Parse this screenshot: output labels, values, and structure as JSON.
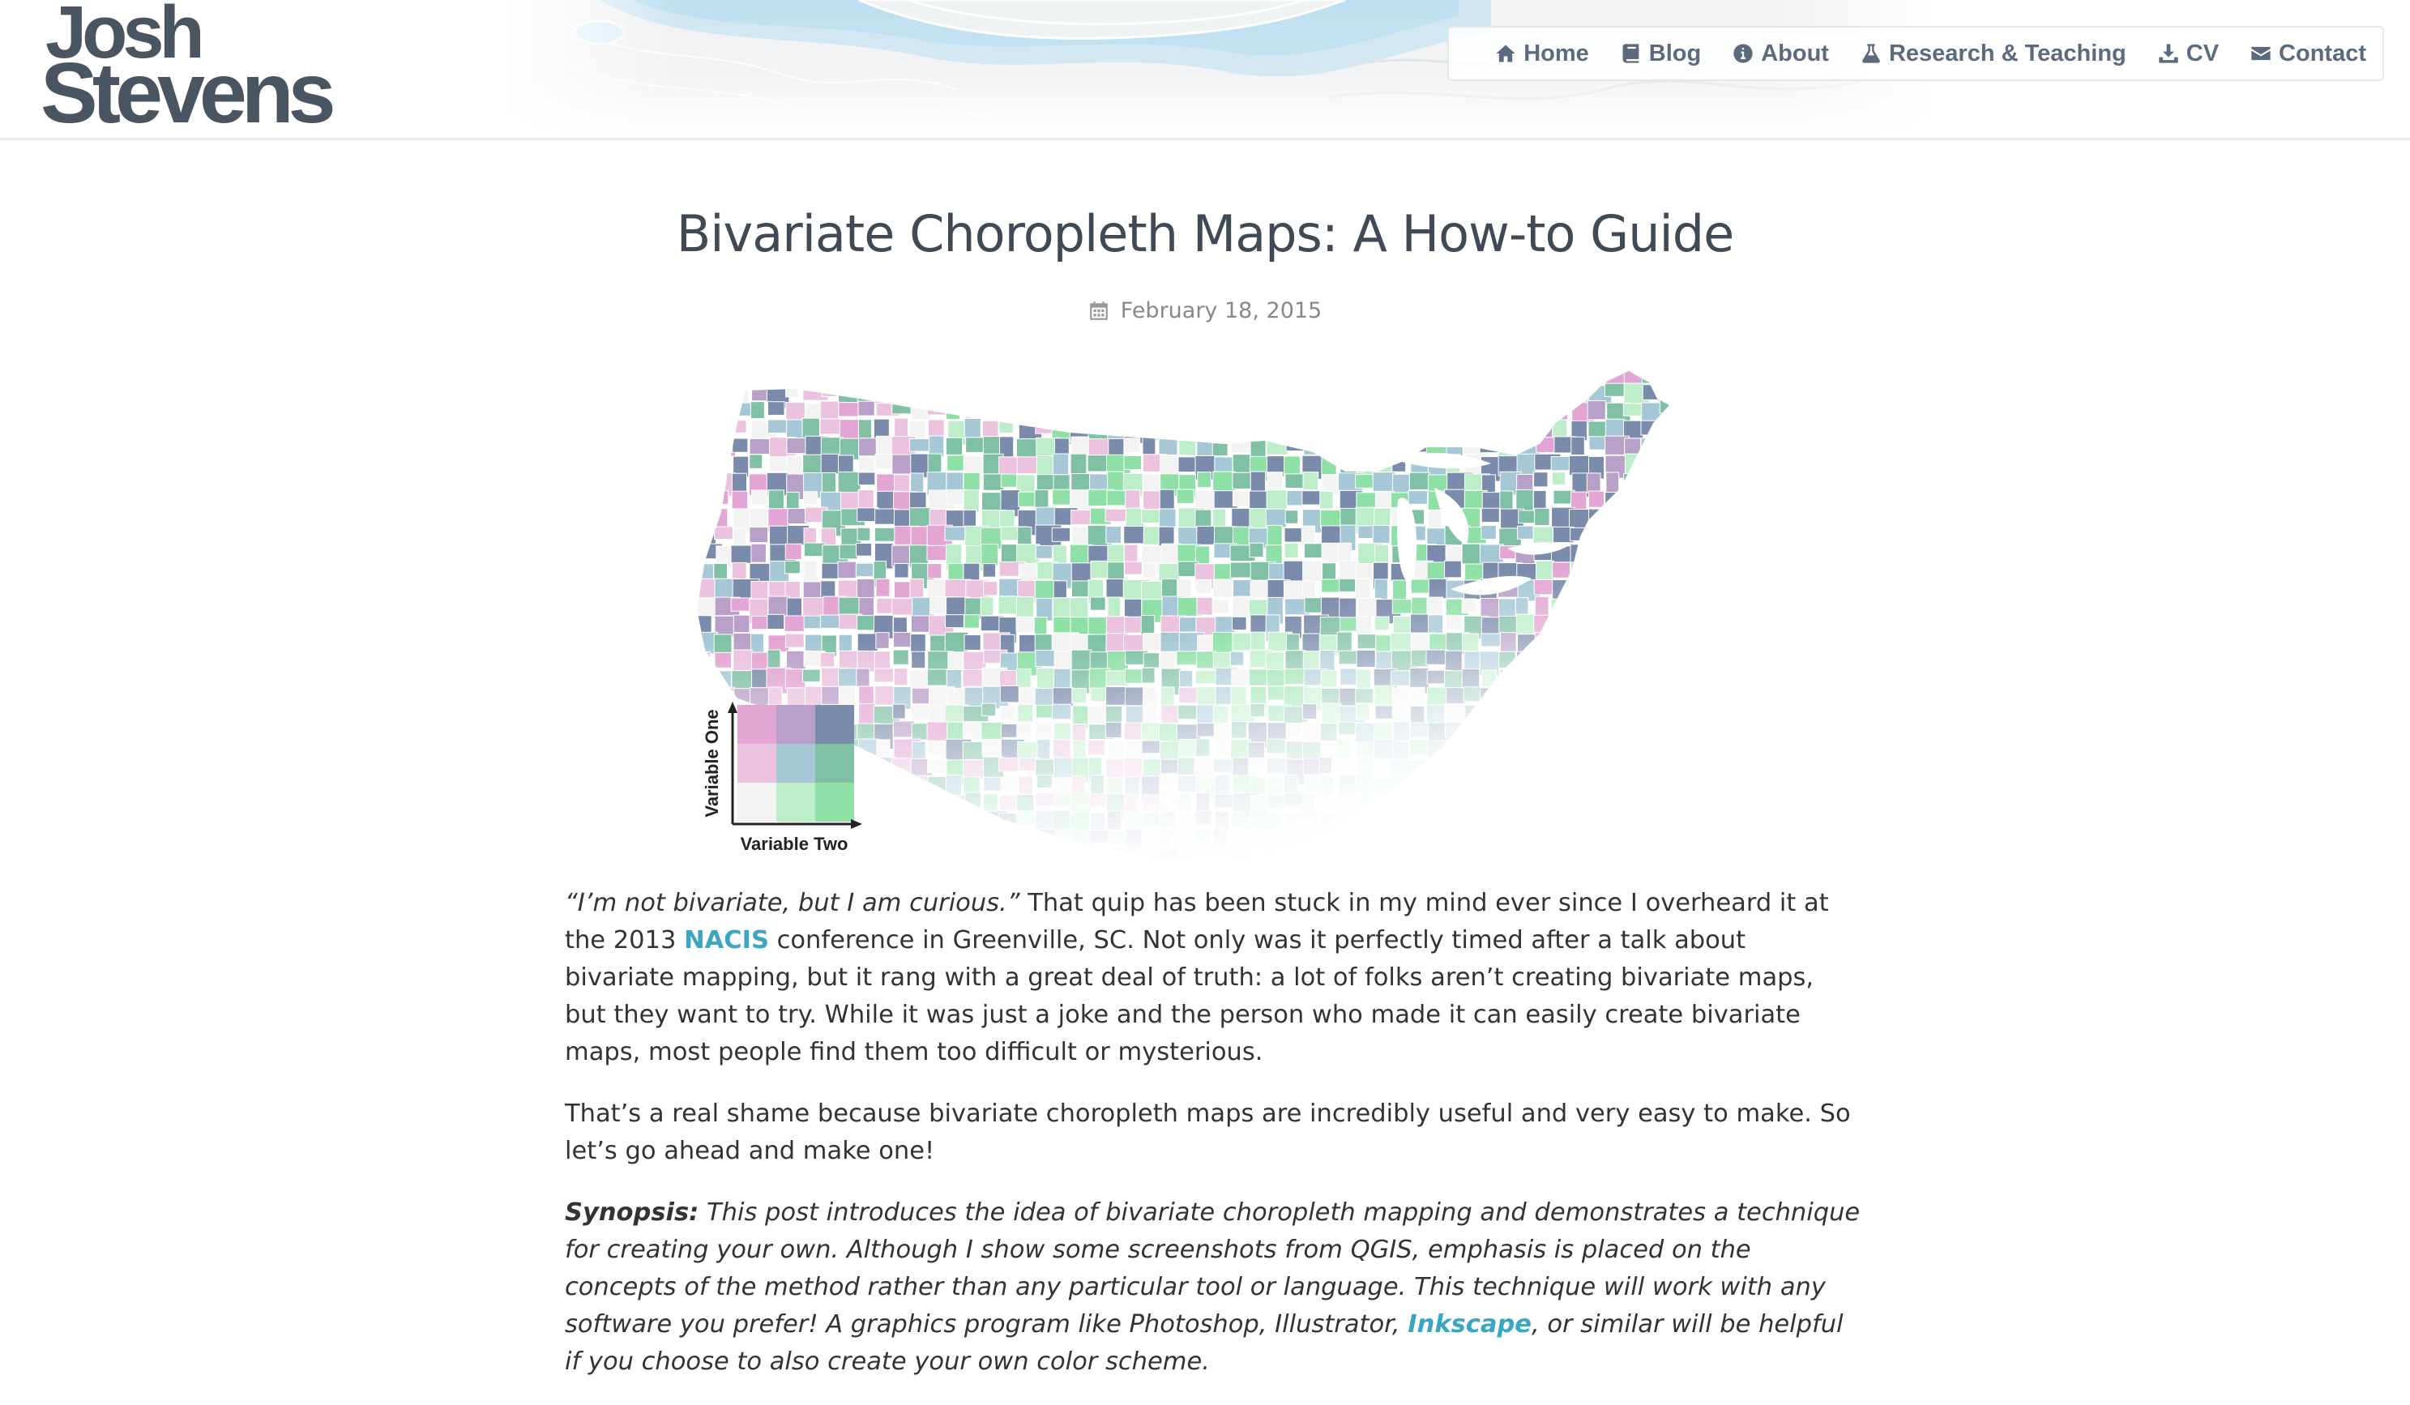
{
  "logo": {
    "line1": "Josh",
    "line2": "Stevens"
  },
  "nav": {
    "items": [
      {
        "label": "Home",
        "icon": "home-icon"
      },
      {
        "label": "Blog",
        "icon": "book-icon"
      },
      {
        "label": "About",
        "icon": "info-icon"
      },
      {
        "label": "Research & Teaching",
        "icon": "flask-icon"
      },
      {
        "label": "CV",
        "icon": "download-icon"
      },
      {
        "label": "Contact",
        "icon": "envelope-icon"
      }
    ]
  },
  "post": {
    "title": "Bivariate Choropleth Maps: A How-to Guide",
    "date": "February 18, 2015"
  },
  "map": {
    "legend_y_label": "Variable One",
    "legend_x_label": "Variable Two",
    "legend_colors": [
      [
        "#e3a5d3",
        "#b9a0c9",
        "#7b8bab"
      ],
      [
        "#ebc3df",
        "#a6c8d6",
        "#80c1a6"
      ],
      [
        "#f3f3f3",
        "#bdeec9",
        "#8ee0a6"
      ]
    ]
  },
  "article": {
    "p1_quote": "“I’m not bivariate, but I am curious.”",
    "p1_text_a": " That quip has been stuck in my mind ever since I overheard it at the 2013 ",
    "p1_link": "NACIS",
    "p1_text_b": " conference in Greenville, SC. Not only was it perfectly timed after a talk about bivariate mapping, but it rang with a great deal of truth: a lot of folks aren’t creating bivariate maps, but they want to try. While it was just a joke and the person who made it can easily create bivariate maps, most people find them too difficult or mysterious.",
    "p2": "That’s a real shame because bivariate choropleth maps are incredibly useful and very easy to make. So let’s go ahead and make one!",
    "p3_label": "Synopsis:",
    "p3_text_a": " This post introduces the idea of bivariate choropleth mapping and demonstrates a technique for creating your own. Although I show some screenshots from QGIS, emphasis is placed on the concepts of the method rather than any particular tool or language. This technique will work with any software you prefer! A graphics program like Photoshop, Illustrator, ",
    "p3_link": "Inkscape",
    "p3_text_b": ", or similar will be helpful if you choose to also create your own color scheme."
  }
}
